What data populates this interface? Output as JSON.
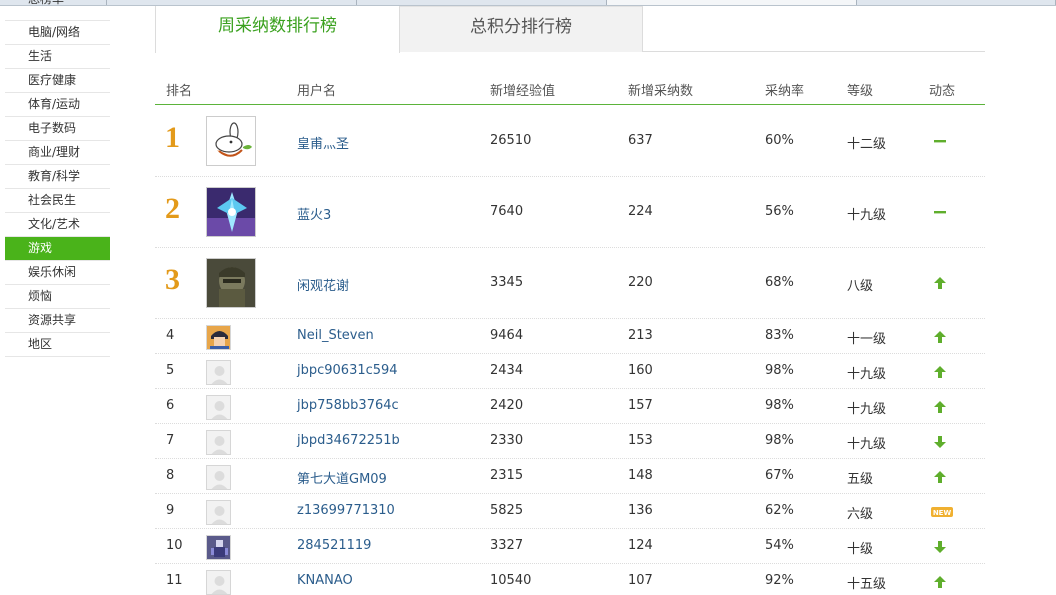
{
  "sidebar": {
    "items": [
      {
        "label": "总榜单",
        "active": false
      },
      {
        "label": "电脑/网络",
        "active": false
      },
      {
        "label": "生活",
        "active": false
      },
      {
        "label": "医疗健康",
        "active": false
      },
      {
        "label": "体育/运动",
        "active": false
      },
      {
        "label": "电子数码",
        "active": false
      },
      {
        "label": "商业/理财",
        "active": false
      },
      {
        "label": "教育/科学",
        "active": false
      },
      {
        "label": "社会民生",
        "active": false
      },
      {
        "label": "文化/艺术",
        "active": false
      },
      {
        "label": "游戏",
        "active": true
      },
      {
        "label": "娱乐休闲",
        "active": false
      },
      {
        "label": "烦恼",
        "active": false
      },
      {
        "label": "资源共享",
        "active": false
      },
      {
        "label": "地区",
        "active": false
      }
    ]
  },
  "tabs": {
    "weekly": "周采纳数排行榜",
    "total": "总积分排行榜"
  },
  "table": {
    "headers": {
      "rank": "排名",
      "user": "用户名",
      "exp": "新增经验值",
      "adopt": "新增采纳数",
      "rate": "采纳率",
      "level": "等级",
      "trend": "动态"
    },
    "rows": [
      {
        "rank": "1",
        "user": "皇甫灬圣",
        "exp": "26510",
        "adopt": "637",
        "rate": "60%",
        "level": "十二级",
        "trend": "flat",
        "avatar": "cartoon-rabbit-icon"
      },
      {
        "rank": "2",
        "user": "蓝火3",
        "exp": "7640",
        "adopt": "224",
        "rate": "56%",
        "level": "十九级",
        "trend": "flat",
        "avatar": "blue-flame-avatar"
      },
      {
        "rank": "3",
        "user": "闲观花谢",
        "exp": "3345",
        "adopt": "220",
        "rate": "68%",
        "level": "八级",
        "trend": "up",
        "avatar": "soldier-avatar"
      },
      {
        "rank": "4",
        "user": "Neil_Steven",
        "exp": "9464",
        "adopt": "213",
        "rate": "83%",
        "level": "十一级",
        "trend": "up",
        "avatar": "anime-avatar"
      },
      {
        "rank": "5",
        "user": "jbpc90631c594",
        "exp": "2434",
        "adopt": "160",
        "rate": "98%",
        "level": "十九级",
        "trend": "up",
        "avatar": "default-user-icon"
      },
      {
        "rank": "6",
        "user": "jbp758bb3764c",
        "exp": "2420",
        "adopt": "157",
        "rate": "98%",
        "level": "十九级",
        "trend": "up",
        "avatar": "default-user-icon"
      },
      {
        "rank": "7",
        "user": "jbpd34672251b",
        "exp": "2330",
        "adopt": "153",
        "rate": "98%",
        "level": "十九级",
        "trend": "down",
        "avatar": "default-user-icon"
      },
      {
        "rank": "8",
        "user": "第七大道GM09",
        "exp": "2315",
        "adopt": "148",
        "rate": "67%",
        "level": "五级",
        "trend": "up",
        "avatar": "default-user-icon"
      },
      {
        "rank": "9",
        "user": "z13699771310",
        "exp": "5825",
        "adopt": "136",
        "rate": "62%",
        "level": "六级",
        "trend": "new",
        "avatar": "default-user-icon"
      },
      {
        "rank": "10",
        "user": "284521119",
        "exp": "3327",
        "adopt": "124",
        "rate": "54%",
        "level": "十级",
        "trend": "down",
        "avatar": "game-character-avatar"
      },
      {
        "rank": "11",
        "user": "KNANAO",
        "exp": "10540",
        "adopt": "107",
        "rate": "92%",
        "level": "十五级",
        "trend": "up",
        "avatar": "default-user-icon"
      }
    ]
  },
  "trend_labels": {
    "new": "NEW"
  },
  "colors": {
    "accent_green": "#4ab31a",
    "rank_gold": "#e39a1a",
    "link_blue": "#2b5d8c",
    "trend_up": "#5fae2c",
    "trend_new": "#f0b030"
  }
}
